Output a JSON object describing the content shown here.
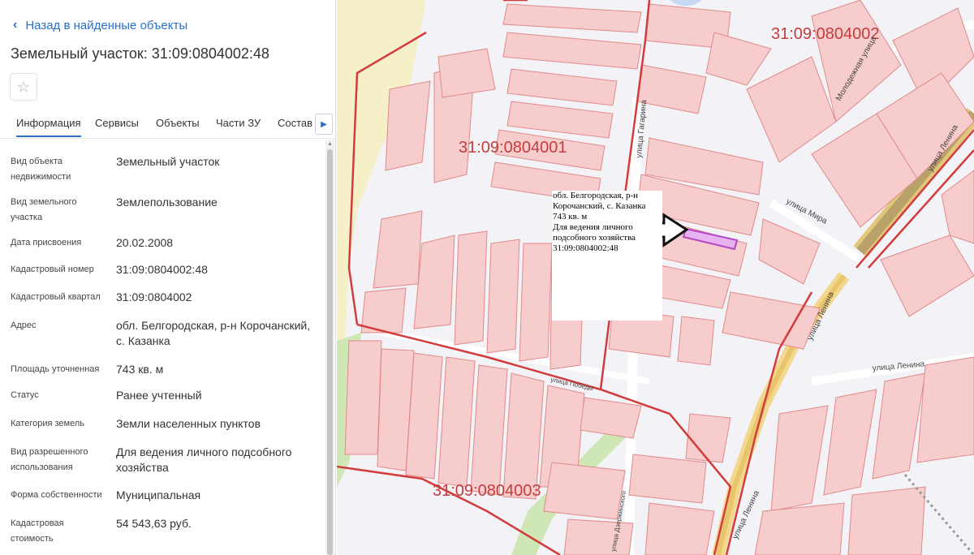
{
  "panel": {
    "back_label": "Назад в найденные объекты",
    "title": "Земельный участок: 31:09:0804002:48",
    "tabs": [
      "Информация",
      "Сервисы",
      "Объекты",
      "Части ЗУ",
      "Состав"
    ],
    "active_tab": "Информация",
    "rows": [
      {
        "label": "Вид объекта недвижимости",
        "value": "Земельный участок"
      },
      {
        "label": "Вид земельного участка",
        "value": "Землепользование"
      },
      {
        "label": "Дата присвоения",
        "value": "20.02.2008"
      },
      {
        "label": "Кадастровый номер",
        "value": "31:09:0804002:48"
      },
      {
        "label": "Кадастровый квартал",
        "value": "31:09:0804002"
      },
      {
        "label": "Адрес",
        "value": "обл. Белгородская, р-н Корочанский, с. Казанка"
      },
      {
        "label": "Площадь уточненная",
        "value": "743 кв. м"
      },
      {
        "label": "Статус",
        "value": "Ранее учтенный"
      },
      {
        "label": "Категория земель",
        "value": "Земли населенных пунктов"
      },
      {
        "label": "Вид разрешенного использования",
        "value": "Для ведения личного подсобного хозяйства"
      },
      {
        "label": "Форма собственности",
        "value": "Муниципальная"
      },
      {
        "label": "Кадастровая стоимость",
        "value": "54 543,63 руб."
      }
    ]
  },
  "map": {
    "quarters": [
      "31:09:0804001",
      "31:09:0804002",
      "31:09:0804003"
    ],
    "streets": [
      "улица Гагарина",
      "Молодежная улица",
      "улица Ленина",
      "улица Мира",
      "улица Ленина",
      "улица Ленина",
      "улица Ленина",
      "улица Победы",
      "улица Дзержинского"
    ],
    "popup_lines": [
      "обл. Белгородская, р-н",
      "Корочанский, с. Казанка",
      "743 кв. м",
      "Для ведения личного",
      "подсобного хозяйства",
      "31:09:0804002:48"
    ],
    "colors": {
      "parcel_fill": "#f7cccc",
      "parcel_stroke": "#e08a8a",
      "quarter_border": "#d23c3c",
      "selected": "#b447c8",
      "accent": "#2a6fc9"
    }
  }
}
